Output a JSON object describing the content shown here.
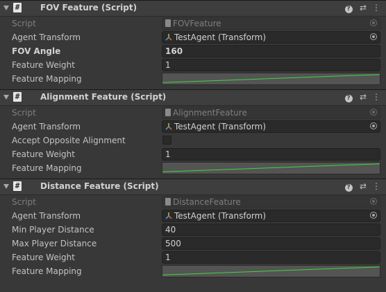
{
  "components": [
    {
      "title": "FOV Feature (Script)",
      "script_label": "Script",
      "script_value": "FOVFeature",
      "fields": [
        {
          "label": "Agent Transform",
          "value": "TestAgent (Transform)",
          "kind": "object"
        },
        {
          "label": "FOV Angle",
          "value": "160",
          "kind": "number",
          "bold": true
        },
        {
          "label": "Feature Weight",
          "value": "1",
          "kind": "number"
        },
        {
          "label": "Feature Mapping",
          "kind": "curve"
        }
      ]
    },
    {
      "title": "Alignment Feature (Script)",
      "script_label": "Script",
      "script_value": "AlignmentFeature",
      "fields": [
        {
          "label": "Agent Transform",
          "value": "TestAgent (Transform)",
          "kind": "object"
        },
        {
          "label": "Accept Opposite Alignment",
          "kind": "toggle",
          "checked": false
        },
        {
          "label": "Feature Weight",
          "value": "1",
          "kind": "number"
        },
        {
          "label": "Feature Mapping",
          "kind": "curve"
        }
      ]
    },
    {
      "title": "Distance Feature (Script)",
      "script_label": "Script",
      "script_value": "DistanceFeature",
      "fields": [
        {
          "label": "Agent Transform",
          "value": "TestAgent (Transform)",
          "kind": "object"
        },
        {
          "label": "Min Player Distance",
          "value": "40",
          "kind": "number"
        },
        {
          "label": "Max Player Distance",
          "value": "500",
          "kind": "number"
        },
        {
          "label": "Feature Weight",
          "value": "1",
          "kind": "number"
        },
        {
          "label": "Feature Mapping",
          "kind": "curve"
        }
      ]
    }
  ],
  "icons": {
    "help": "help-icon",
    "presets": "presets-icon",
    "menu": "kebab-menu-icon",
    "script": "script-icon",
    "transform": "transform-icon",
    "picker": "object-picker-icon"
  },
  "colors": {
    "curve_line": "#3cd83c",
    "curve_bg": "#545454",
    "panel_bg": "#383838",
    "header_bg": "#3e3e3e"
  }
}
